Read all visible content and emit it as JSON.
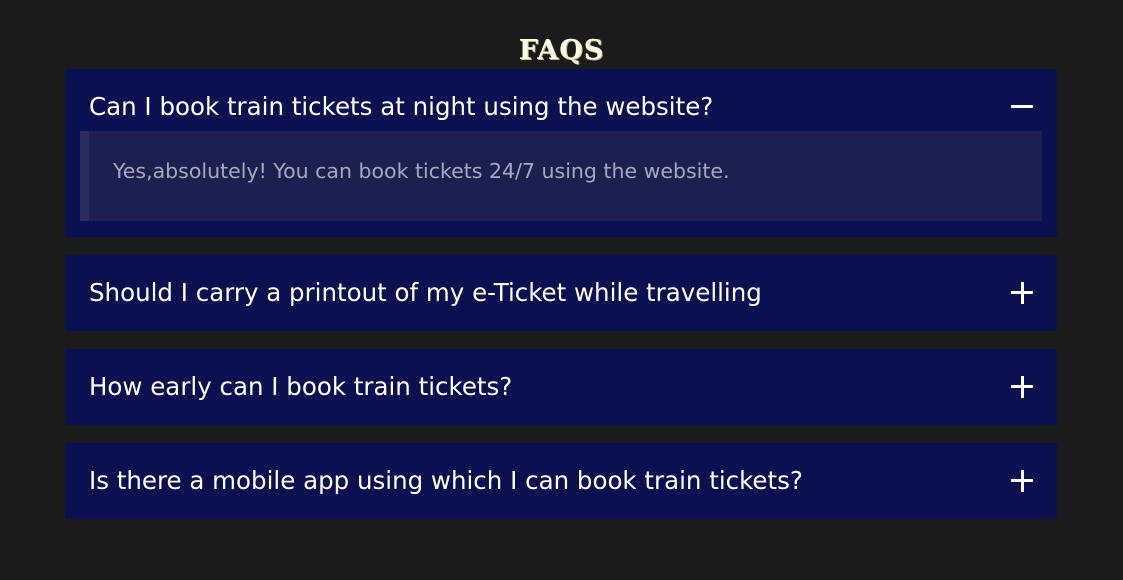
{
  "page": {
    "title": "FAQS"
  },
  "colors": {
    "background": "#1b1b1b",
    "card": "#0b1050",
    "answer_panel": "#1b2050",
    "answer_border": "#2a2c60",
    "question_text": "#ffffff",
    "answer_text": "#a8a8b8"
  },
  "faqs": [
    {
      "question": "Can I book train tickets at night using the website?",
      "answer": "Yes,absolutely! You can book tickets 24/7 using the website.",
      "expanded": true,
      "toggle_icon": "minus-icon"
    },
    {
      "question": "Should I carry a printout of my e-Ticket while travelling",
      "expanded": false,
      "toggle_icon": "plus-icon"
    },
    {
      "question": "How early can I book train tickets?",
      "expanded": false,
      "toggle_icon": "plus-icon"
    },
    {
      "question": "Is there a mobile app using which I can book train tickets?",
      "expanded": false,
      "toggle_icon": "plus-icon"
    }
  ]
}
